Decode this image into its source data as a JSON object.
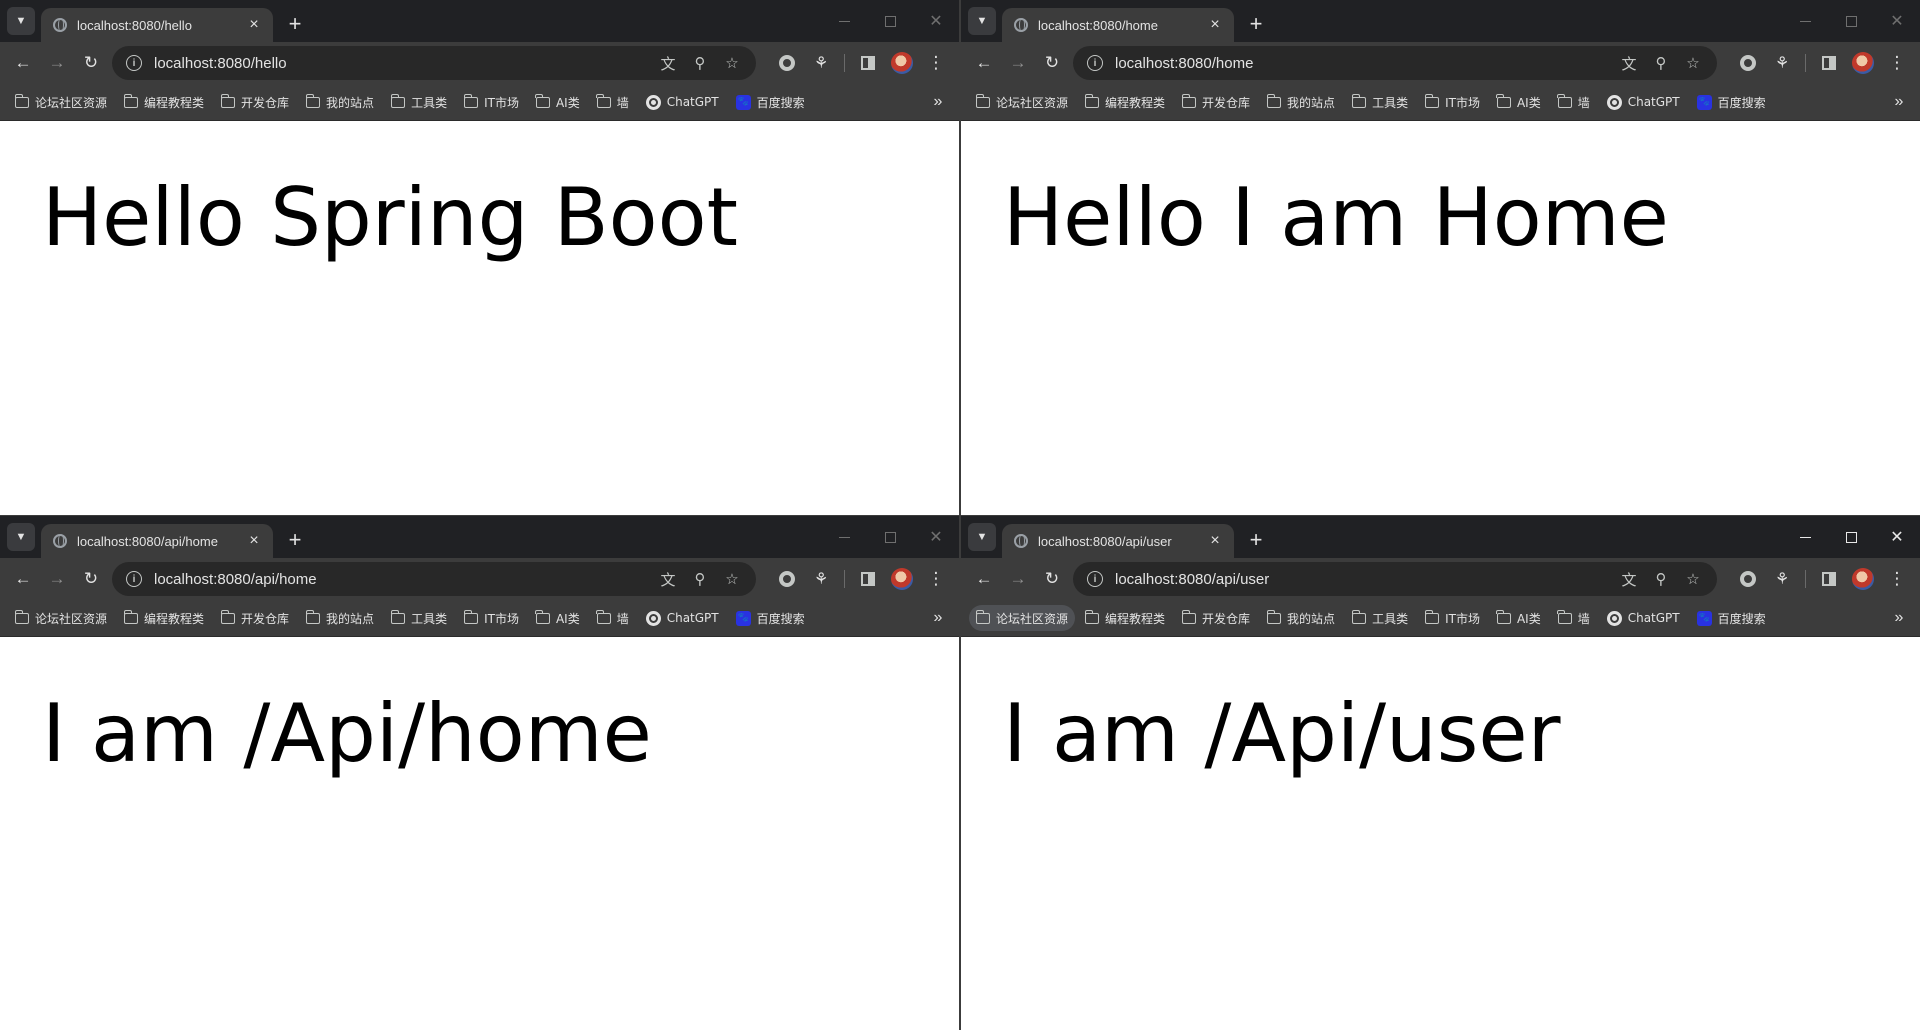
{
  "bookmarks": [
    {
      "label": "论坛社区资源",
      "icon": "folder-icon"
    },
    {
      "label": "编程教程类",
      "icon": "folder-icon"
    },
    {
      "label": "开发仓库",
      "icon": "folder-icon"
    },
    {
      "label": "我的站点",
      "icon": "folder-icon"
    },
    {
      "label": "工具类",
      "icon": "folder-icon"
    },
    {
      "label": "IT市场",
      "icon": "folder-icon"
    },
    {
      "label": "AI类",
      "icon": "folder-icon"
    },
    {
      "label": "墙",
      "icon": "folder-icon"
    },
    {
      "label": "ChatGPT",
      "icon": "chatgpt-icon"
    },
    {
      "label": "百度搜索",
      "icon": "baidu-icon"
    }
  ],
  "windows": [
    {
      "tab_title": "localhost:8080/hello",
      "url": "localhost:8080/hello",
      "heading": "Hello Spring Boot"
    },
    {
      "tab_title": "localhost:8080/home",
      "url": "localhost:8080/home",
      "heading": "Hello I am Home"
    },
    {
      "tab_title": "localhost:8080/api/home",
      "url": "localhost:8080/api/home",
      "heading": "I am /Api/home"
    },
    {
      "tab_title": "localhost:8080/api/user",
      "url": "localhost:8080/api/user",
      "heading": "I am /Api/user",
      "active": true
    }
  ],
  "colors": {
    "tabstrip": "#202124",
    "toolbar": "#3c3c3c",
    "omnibox": "#282828",
    "page_bg": "#ffffff",
    "heading_text": "#000000"
  }
}
